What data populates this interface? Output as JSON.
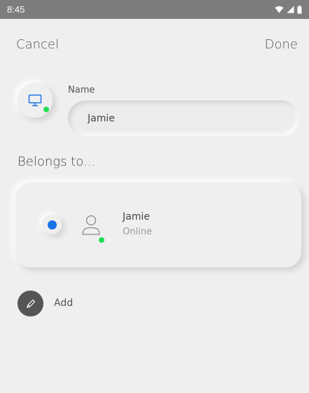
{
  "status_bar": {
    "time": "8:45",
    "icons": [
      "wifi-icon",
      "signal-icon",
      "battery-icon"
    ]
  },
  "header": {
    "cancel_label": "Cancel",
    "done_label": "Done"
  },
  "device": {
    "icon": "monitor-icon",
    "online": true
  },
  "name_field": {
    "label": "Name",
    "value": "Jamie"
  },
  "belongs_to": {
    "title": "Belongs to...",
    "items": [
      {
        "name": "Jamie",
        "status": "Online",
        "selected": true,
        "icon": "user-icon"
      }
    ]
  },
  "add": {
    "label": "Add",
    "icon": "pencil-icon"
  },
  "colors": {
    "background": "#efefef",
    "status_bar": "#7d7d7d",
    "accent_blue": "#1a73e8",
    "online_green": "#22dd55",
    "add_button": "#555555"
  }
}
